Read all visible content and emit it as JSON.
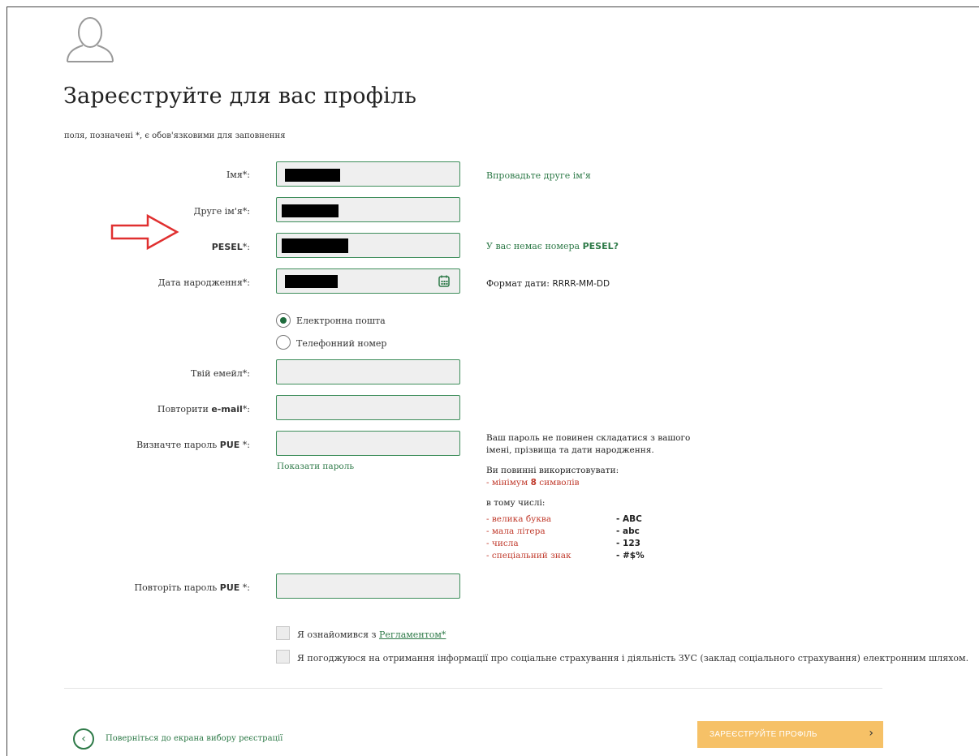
{
  "page": {
    "title": "Зареєструйте для вас профіль",
    "required_note": "поля, позначені *, є обов'язковими для заповнення"
  },
  "form": {
    "first_name": {
      "label": "Імя*:",
      "hint": "Впровадьте друге ім'я"
    },
    "second_name": {
      "label": "Друге ім'я*:"
    },
    "pesel": {
      "label_bold": "PESEL",
      "label_suffix": "*:",
      "hint_prefix": "У вас немає номера ",
      "hint_bold": "PESEL?"
    },
    "birth_date": {
      "label": "Дата народження*:",
      "hint_prefix": "Формат дати: ",
      "hint_format": "RRRR-MM-DD"
    },
    "contact_options": [
      {
        "label": "Електронна пошта",
        "selected": true
      },
      {
        "label": "Телефонний номер",
        "selected": false
      }
    ],
    "email": {
      "label": "Твій емейл*:"
    },
    "email_repeat": {
      "label_prefix": "Повторити ",
      "label_bold": "e-mail",
      "label_suffix": "*:"
    },
    "password": {
      "label_prefix": "Визначте пароль ",
      "label_bold": "PUE",
      "label_suffix": " *:",
      "show_password": "Показати пароль"
    },
    "password_repeat": {
      "label_prefix": "Повторіть пароль ",
      "label_bold": "PUE",
      "label_suffix": " *:"
    }
  },
  "password_rules": {
    "intro_line1": "Ваш пароль не повинен складатися з вашого",
    "intro_line2": "імені, прізвища та дати народження.",
    "must_use": "Ви повинні використовувати:",
    "min_prefix": "- мінімум ",
    "min_count": "8",
    "min_suffix": " символів",
    "including": "в тому числі:",
    "items": [
      {
        "text": "- велика буква",
        "example": "- ABC"
      },
      {
        "text": "- мала літера",
        "example": "- abc"
      },
      {
        "text": "- числа",
        "example": "- 123"
      },
      {
        "text": "- спеціальний знак",
        "example": "- #$%"
      }
    ]
  },
  "consents": {
    "regulations_prefix": "Я ознайомився з ",
    "regulations_link": "Регламентом*",
    "info_consent": "Я погоджуюся на отримання інформації про соціальне страхування і діяльність ЗУС (заклад соціального страхування) електронним шляхом."
  },
  "footer": {
    "back_label": "Поверніться до екрана вибору реєстрації",
    "submit_label": "ЗАРЕЄСТРУЙТЕ ПРОФІЛЬ",
    "submit_arrow": "›",
    "back_arrow": "‹"
  },
  "colors": {
    "accent_green": "#2e7a48",
    "submit_bg": "#f6c167",
    "error_red": "#c0392b",
    "annotation_arrow": "#e03030"
  }
}
